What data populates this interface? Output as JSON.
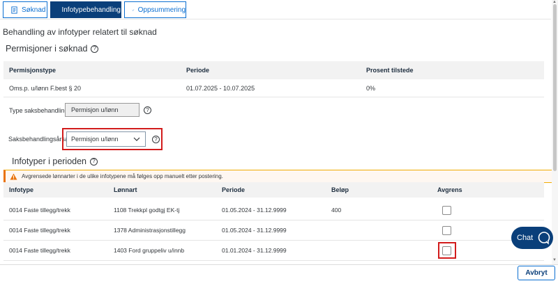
{
  "tabs": [
    {
      "label": "Søknad"
    },
    {
      "label": "Infotypebehandling"
    },
    {
      "label": "Oppsummering"
    }
  ],
  "page_heading": "Behandling av infotyper relatert til søknad",
  "permisjoner": {
    "title": "Permisjoner i søknad",
    "columns": [
      "Permisjonstype",
      "Periode",
      "Prosent tilstede"
    ],
    "rows": [
      {
        "type": "Oms.p. u/lønn F.best § 20",
        "periode": "01.07.2025 - 10.07.2025",
        "prosent": "0%"
      }
    ]
  },
  "form": {
    "type_label": "Type saksbehandling:",
    "type_value": "Permisjon u/lønn",
    "aarsak_label": "Saksbehandlingsårsak:",
    "aarsak_value": "Permisjon u/lønn"
  },
  "infotyper": {
    "title": "Infotyper i perioden",
    "warning": "Avgrensede lønnarter i de ulike infotypene må følges opp manuelt etter postering.",
    "columns": [
      "Infotype",
      "Lønnart",
      "Periode",
      "Beløp",
      "Avgrens"
    ],
    "rows": [
      {
        "infotype": "0014 Faste tillegg/trekk",
        "lonnart": "1108 Trekkpl godtgj EK-tj",
        "periode": "01.05.2024 - 31.12.9999",
        "belop": "400",
        "avgrens": false
      },
      {
        "infotype": "0014 Faste tillegg/trekk",
        "lonnart": "1378 Administrasjonstillegg",
        "periode": "01.05.2024 - 31.12.9999",
        "belop": "",
        "avgrens": false
      },
      {
        "infotype": "0014 Faste tillegg/trekk",
        "lonnart": "1403 Ford gruppeliv u/innb",
        "periode": "01.01.2024 - 31.12.9999",
        "belop": "",
        "avgrens": false
      }
    ]
  },
  "chat": {
    "label": "Chat"
  },
  "footer": {
    "cancel_label": "Avbryt"
  },
  "colors": {
    "primary": "#0a3f7a",
    "accent": "#0a6ed1",
    "highlight": "#d21b1b",
    "warning": "#e9730c"
  },
  "icons": {
    "help": "question-circle-icon",
    "warning": "warning-triangle-icon",
    "check": "checkmark-icon"
  }
}
